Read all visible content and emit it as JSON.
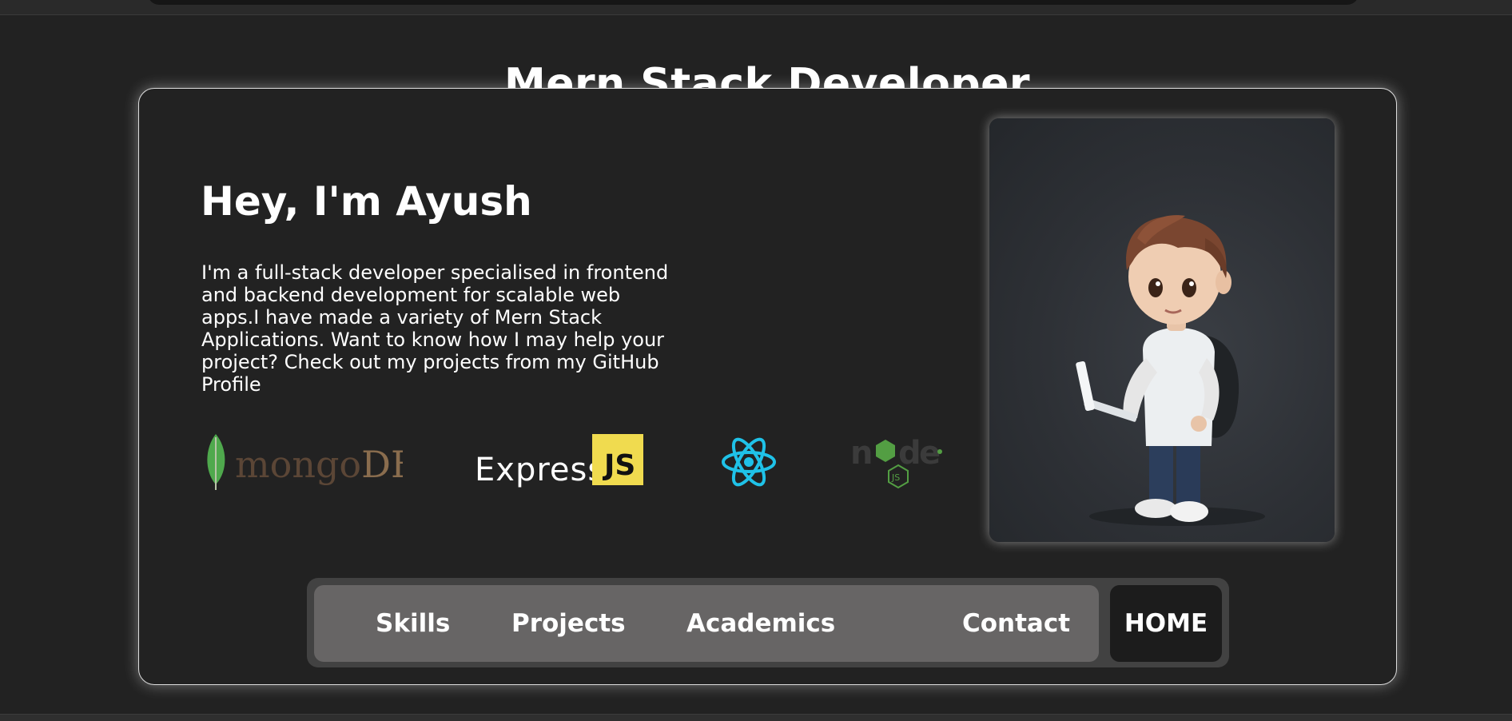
{
  "page": {
    "heading": "Mern Stack Developer"
  },
  "hero": {
    "title": "Hey, I'm Ayush",
    "description": "I'm a full-stack developer specialised in frontend and backend development for scalable web apps.I have made a variety of Mern Stack Applications. Want to know how I may help your project? Check out my projects from my GitHub Profile"
  },
  "tech_logos": {
    "mongo": {
      "text_mongo": "mongo",
      "text_db": "DB",
      "icon": "mongodb-leaf-icon"
    },
    "express": {
      "text": "Express",
      "badge": "JS"
    },
    "react": {
      "icon": "react-atom-icon"
    },
    "node": {
      "text_n": "n",
      "text_d": "d",
      "text_e": "e",
      "badge": "JS",
      "icon": "nodejs-hexagon-icon"
    }
  },
  "portrait": {
    "icon": "cartoon-developer-avatar"
  },
  "navbar": {
    "links": [
      "Skills",
      "Projects",
      "Academics",
      "Contact"
    ],
    "home": "HOME"
  },
  "colors": {
    "background": "#222222",
    "nav_links_bg": "#676565",
    "nav_home_bg": "#1c1c1c",
    "mongo_green": "#4fa94d",
    "mongo_brown": "#5b4636",
    "express_yellow": "#f0db4f",
    "react_cyan": "#1fc2e8",
    "node_green": "#539e43"
  }
}
